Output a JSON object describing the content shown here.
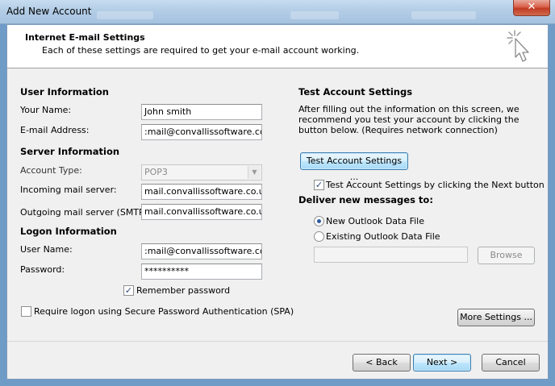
{
  "window": {
    "title": "Add New Account",
    "close_glyph": "✕"
  },
  "header": {
    "title": "Internet E-mail Settings",
    "subtitle": "Each of these settings are required to get your e-mail account working.",
    "icon": "cursor-click-icon"
  },
  "user_info": {
    "heading": "User Information",
    "name_label": "Your Name:",
    "name_value": "John smith",
    "email_label": "E-mail Address:",
    "email_value": ":mail@convallissoftware.co.uk"
  },
  "server_info": {
    "heading": "Server Information",
    "account_type_label": "Account Type:",
    "account_type_value": "POP3",
    "incoming_label": "Incoming mail server:",
    "incoming_value": "mail.convallissoftware.co.uk",
    "outgoing_label": "Outgoing mail server (SMTP):",
    "outgoing_value": "mail.convallissoftware.co.uk"
  },
  "logon_info": {
    "heading": "Logon Information",
    "username_label": "User Name:",
    "username_value": ":mail@convallissoftware.co.uk",
    "password_label": "Password:",
    "password_value": "**********",
    "remember_label": "Remember password",
    "remember_checked": true,
    "spa_label": "Require logon using Secure Password Authentication (SPA)",
    "spa_checked": false
  },
  "test_settings": {
    "heading": "Test Account Settings",
    "description": "After filling out the information on this screen, we recommend you test your account by clicking the button below. (Requires network connection)",
    "test_button": "Test Account Settings ...",
    "test_next_label": "Test Account Settings by clicking the Next button",
    "test_next_checked": true
  },
  "deliver": {
    "heading": "Deliver new messages to:",
    "option_new": "New Outlook Data File",
    "option_existing": "Existing Outlook Data File",
    "selected": "new",
    "existing_path": "",
    "browse_button": "Browse"
  },
  "buttons": {
    "more_settings": "More Settings ...",
    "back": "< Back",
    "next": "Next >",
    "cancel": "Cancel"
  },
  "checkmark_glyph": "✓"
}
